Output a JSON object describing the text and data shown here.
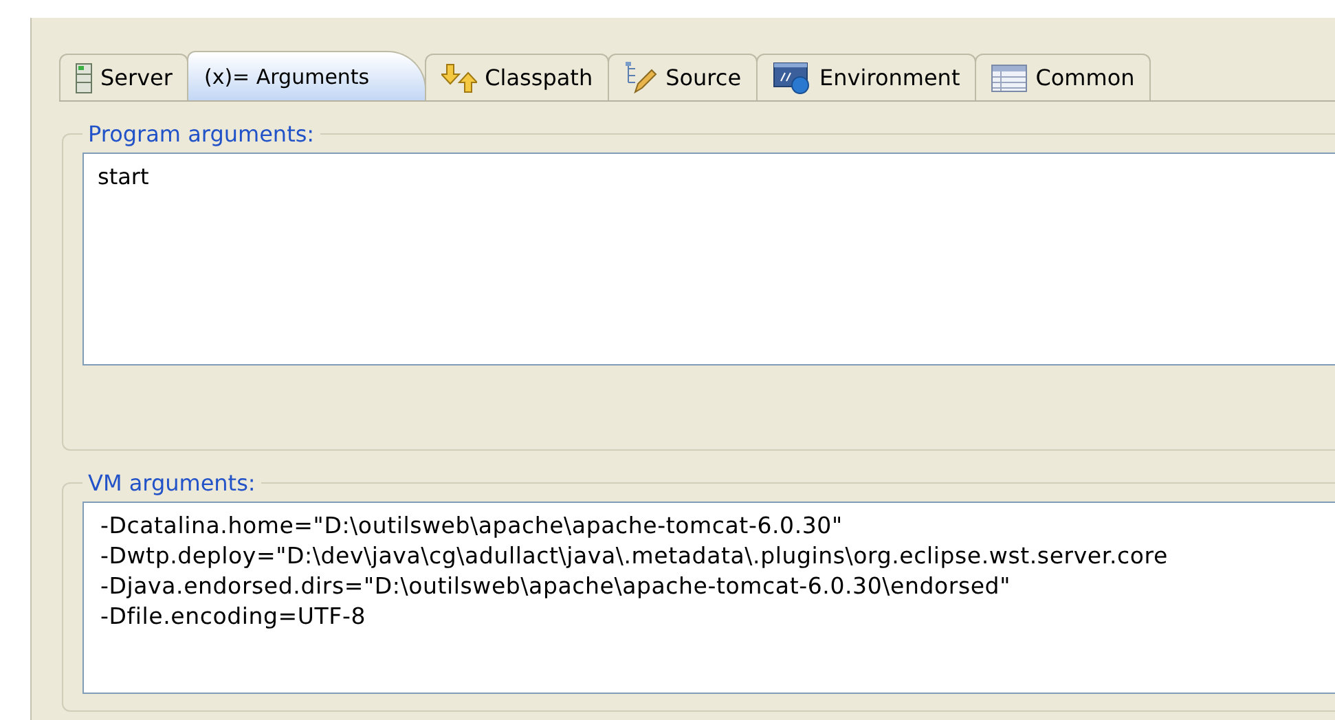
{
  "tabs": [
    {
      "label": "Server",
      "kind": "server",
      "selected": false
    },
    {
      "label": "(x)= Arguments",
      "kind": "arguments",
      "selected": true
    },
    {
      "label": "Classpath",
      "kind": "classpath",
      "selected": false
    },
    {
      "label": "Source",
      "kind": "source",
      "selected": false
    },
    {
      "label": "Environment",
      "kind": "environment",
      "selected": false
    },
    {
      "label": "Common",
      "kind": "common",
      "selected": false
    }
  ],
  "program_arguments": {
    "label": "Program arguments:",
    "lines": [
      "start"
    ]
  },
  "vm_arguments": {
    "label": "VM arguments:",
    "lines": [
      "-Dcatalina.home=\"D:\\outilsweb\\apache\\apache-tomcat-6.0.30\"",
      "-Dwtp.deploy=\"D:\\dev\\java\\cg\\adullact\\java\\.metadata\\.plugins\\org.eclipse.wst.server.core",
      "-Djava.endorsed.dirs=\"D:\\outilsweb\\apache\\apache-tomcat-6.0.30\\endorsed\"",
      "-Dfile.encoding=UTF-8"
    ]
  }
}
